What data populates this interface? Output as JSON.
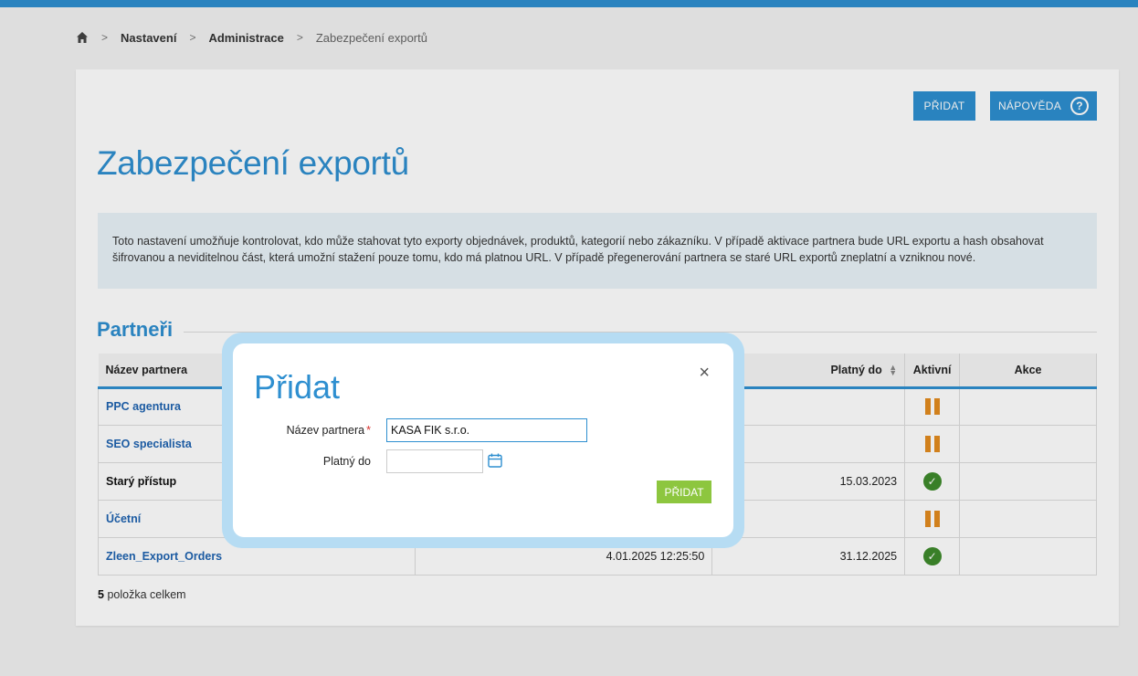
{
  "colors": {
    "accent": "#2e8fd0",
    "add_button": "#8dc63f",
    "inactive": "#e38b1f",
    "active": "#3e8a2c",
    "link": "#1f63b0"
  },
  "breadcrumb": {
    "home_icon": "home-icon",
    "items": [
      "Nastavení",
      "Administrace",
      "Zabezpečení exportů"
    ]
  },
  "header": {
    "add_label": "PŘIDAT",
    "help_label": "NÁPOVĚDA",
    "help_icon": "?"
  },
  "page": {
    "title": "Zabezpečení exportů",
    "info_line1": "Toto nastavení umožňuje kontrolovat, kdo může stahovat tyto exporty objednávek, produktů, kategorií nebo zákazníku. V případě aktivace partnera bude URL exportu a hash obsahovat",
    "info_line2": "šifrovanou a neviditelnou část, která umožní stažení pouze tomu, kdo má platnou URL. V případě přegenerování partnera se staré URL exportů zneplatní a vzniknou nové."
  },
  "partners": {
    "section_title": "Partneři",
    "columns": {
      "name": "Název partnera",
      "valid_until": "Platný do",
      "active": "Aktivní",
      "actions": "Akce"
    },
    "rows": [
      {
        "name": "PPC agentura",
        "created": "",
        "valid_until": "",
        "active": false
      },
      {
        "name": "SEO specialista",
        "created": "",
        "valid_until": "",
        "active": false
      },
      {
        "name": "Starý přístup",
        "created": "",
        "valid_until": "15.03.2023",
        "active": true
      },
      {
        "name": "Účetní",
        "created": "",
        "valid_until": "",
        "active": false
      },
      {
        "name": "Zleen_Export_Orders",
        "created": "4.01.2025 12:25:50",
        "valid_until": "31.12.2025",
        "active": true
      }
    ],
    "total_count": "5",
    "total_label": "položka celkem"
  },
  "modal": {
    "title": "Přidat",
    "close_icon": "×",
    "name_label": "Název partnera",
    "required_mark": "*",
    "name_value": "KASA FIK s.r.o.",
    "date_label": "Platný do",
    "date_value": "",
    "submit_label": "PŘIDAT"
  }
}
